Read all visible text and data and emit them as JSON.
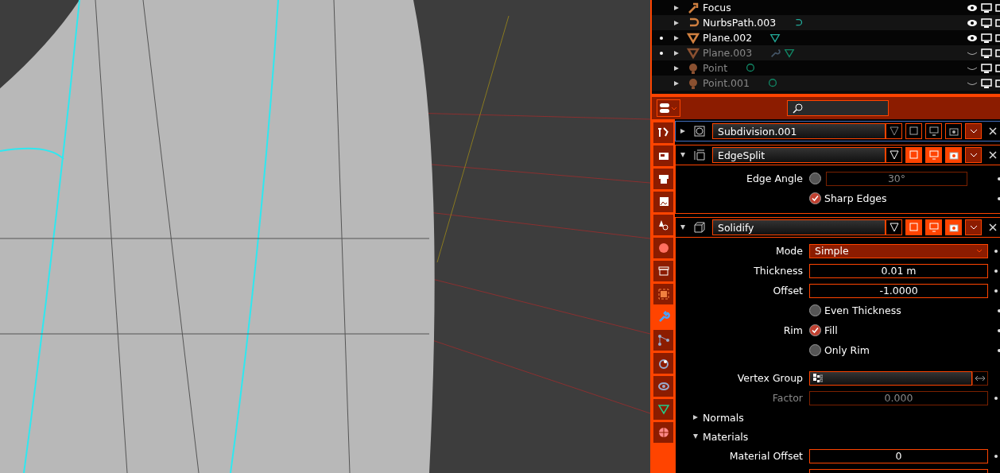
{
  "outliner": {
    "rows": [
      {
        "name": "Focus",
        "dimmed": false,
        "dot": false,
        "visible": true
      },
      {
        "name": "NurbsPath.003",
        "dimmed": false,
        "dot": false,
        "visible": true
      },
      {
        "name": "Plane.002",
        "dimmed": false,
        "dot": true,
        "visible": true
      },
      {
        "name": "Plane.003",
        "dimmed": true,
        "dot": true,
        "visible": false
      },
      {
        "name": "Point",
        "dimmed": true,
        "dot": false,
        "visible": false
      },
      {
        "name": "Point.001",
        "dimmed": true,
        "dot": false,
        "visible": false
      }
    ]
  },
  "properties": {
    "tabs": [
      {
        "selected": false
      },
      {
        "selected": false
      },
      {
        "selected": false
      },
      {
        "selected": false
      },
      {
        "selected": false
      },
      {
        "selected": false
      },
      {
        "selected": false
      },
      {
        "selected": false
      },
      {
        "selected": true
      },
      {
        "selected": false
      },
      {
        "selected": false
      },
      {
        "selected": false
      },
      {
        "selected": false
      },
      {
        "selected": false
      }
    ],
    "modifiers": [
      {
        "name": "Subdivision.001",
        "expanded": false,
        "enabled": false
      },
      {
        "name": "EdgeSplit",
        "expanded": true,
        "enabled": true,
        "fields": [
          {
            "kind": "checknumber",
            "label": "Edge Angle",
            "checked": false,
            "value": "30°"
          },
          {
            "kind": "checkbox",
            "label": "Sharp Edges",
            "checked": true
          }
        ]
      },
      {
        "name": "Solidify",
        "expanded": true,
        "enabled": true,
        "fields": [
          {
            "kind": "dropdown",
            "label": "Mode",
            "value": "Simple"
          },
          {
            "kind": "number",
            "label": "Thickness",
            "value": "0.01 m",
            "disabled": false
          },
          {
            "kind": "number",
            "label": "Offset",
            "value": "-1.0000",
            "disabled": false
          },
          {
            "kind": "checkbox",
            "label": "Even Thickness",
            "checked": false
          },
          {
            "kind": "checkbox",
            "label": "Rim",
            "text": "Fill",
            "checked": true
          },
          {
            "kind": "checkbox",
            "label": "Only Rim",
            "checked": false
          },
          {
            "kind": "spacer"
          },
          {
            "kind": "vgroup",
            "label": "Vertex Group"
          },
          {
            "kind": "number",
            "label": "Factor",
            "value": "0.000",
            "disabled": true
          },
          {
            "kind": "subpanel",
            "label": "Normals",
            "expanded": false
          },
          {
            "kind": "subpanel",
            "label": "Materials",
            "expanded": true
          },
          {
            "kind": "number",
            "label": "Material Offset",
            "value": "0",
            "disabled": false
          },
          {
            "kind": "number",
            "disabled": false
          }
        ]
      }
    ]
  }
}
